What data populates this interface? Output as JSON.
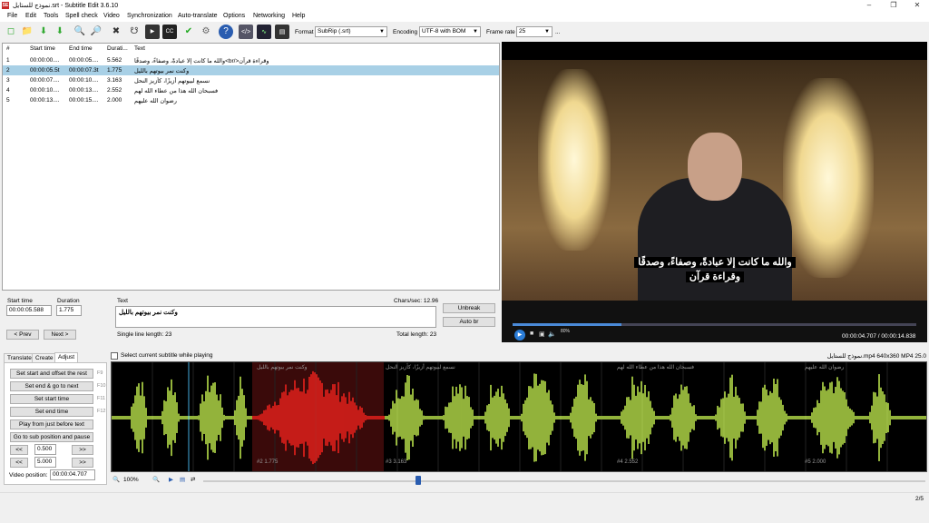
{
  "window": {
    "title": "نموذج للستايل.srt - Subtitle Edit 3.6.10",
    "app_icon": "SE"
  },
  "menu": [
    "File",
    "Edit",
    "Tools",
    "Spell check",
    "Video",
    "Synchronization",
    "Auto-translate",
    "Options",
    "Networking",
    "Help"
  ],
  "toolbar": {
    "format_label": "Format",
    "format_value": "SubRip (.srt)",
    "encoding_label": "Encoding",
    "encoding_value": "UTF-8 with BOM",
    "framerate_label": "Frame rate",
    "framerate_value": "25",
    "more": "..."
  },
  "grid": {
    "headers": [
      "#",
      "Start time",
      "End time",
      "Durati...",
      "Text"
    ],
    "rows": [
      {
        "num": "1",
        "start": "00:00:00....",
        "end": "00:00:05....",
        "dur": "5.562",
        "text": "والله ما كانت إلا عبادةً، وصفاءً، وصدقًا<br/>وقراءة قرآن"
      },
      {
        "num": "2",
        "start": "00:00:05.5t",
        "end": "00:00:07.3t",
        "dur": "1.775",
        "text": "وكنت نمر بيوتهم بالليل"
      },
      {
        "num": "3",
        "start": "00:00:07....",
        "end": "00:00:10....",
        "dur": "3.163",
        "text": "نسمع لبيوتهم أزيزًا، كأزيز النحل"
      },
      {
        "num": "4",
        "start": "00:00:10....",
        "end": "00:00:13....",
        "dur": "2.552",
        "text": "فسبحان الله هذا من عطاء الله لهم"
      },
      {
        "num": "5",
        "start": "00:00:13....",
        "end": "00:00:15....",
        "dur": "2.000",
        "text": "رضوان الله عليهم"
      }
    ]
  },
  "edit": {
    "start_time_label": "Start time",
    "start_time_value": "00:00:05.588",
    "duration_label": "Duration",
    "duration_value": "1.775",
    "text_label": "Text",
    "chars_sec": "Chars/sec: 12.96",
    "text_value": "وكنت نمر بيوتهم بالليل",
    "single_line_length": "Single line length: 23",
    "total_length": "Total length: 23",
    "unbreak": "Unbreak",
    "auto_br": "Auto br",
    "prev": "< Prev",
    "next": "Next >"
  },
  "video": {
    "subtitle_line1": "والله ما كانت إلا عبادةً، وصفاءً، وصدقًا",
    "subtitle_line2": "وقراءة قرآن",
    "time": "00:00:04.707 / 00:00:14.838",
    "volume": "80%"
  },
  "tabs": [
    "Translate",
    "Create",
    "Adjust"
  ],
  "adjust": {
    "set_start_offset": "Set start and offset the rest",
    "set_end_next": "Set end & go to next",
    "set_start": "Set start time",
    "set_end": "Set end time",
    "play_before": "Play from just before text",
    "go_sub": "Go to sub position and pause",
    "f9": "F9",
    "f10": "F10",
    "f11": "F11",
    "f12": "F12",
    "back_small": "<<",
    "fwd_small": ">>",
    "small_step": "0.500",
    "back_large": "<<",
    "fwd_large": ">>",
    "large_step": "5.000",
    "video_position_label": "Video position:",
    "video_position_value": "00:00:04.707"
  },
  "waveform": {
    "select_current_label": "Select current subtitle while playing",
    "info": "نموذج للستايل.mp4 640x360 MP4 25.0",
    "zoom": "100%",
    "segments": [
      {
        "label": "وكنت نمر بيوتهم بالليل",
        "num": "#2  1.775"
      },
      {
        "label": "نسمع لبيوتهم أزيزًا، كأزيز النحل",
        "num": "#3  3.163"
      },
      {
        "label": "فسبحان الله هذا من عطاء الله لهم",
        "num": "#4  2.552"
      },
      {
        "label": "رضوان الله عليهم",
        "num": "#5  2.000"
      }
    ],
    "colors": {
      "wave": "#b8e04a",
      "selected": "#e8201c"
    }
  },
  "status": {
    "page": "2/5"
  }
}
